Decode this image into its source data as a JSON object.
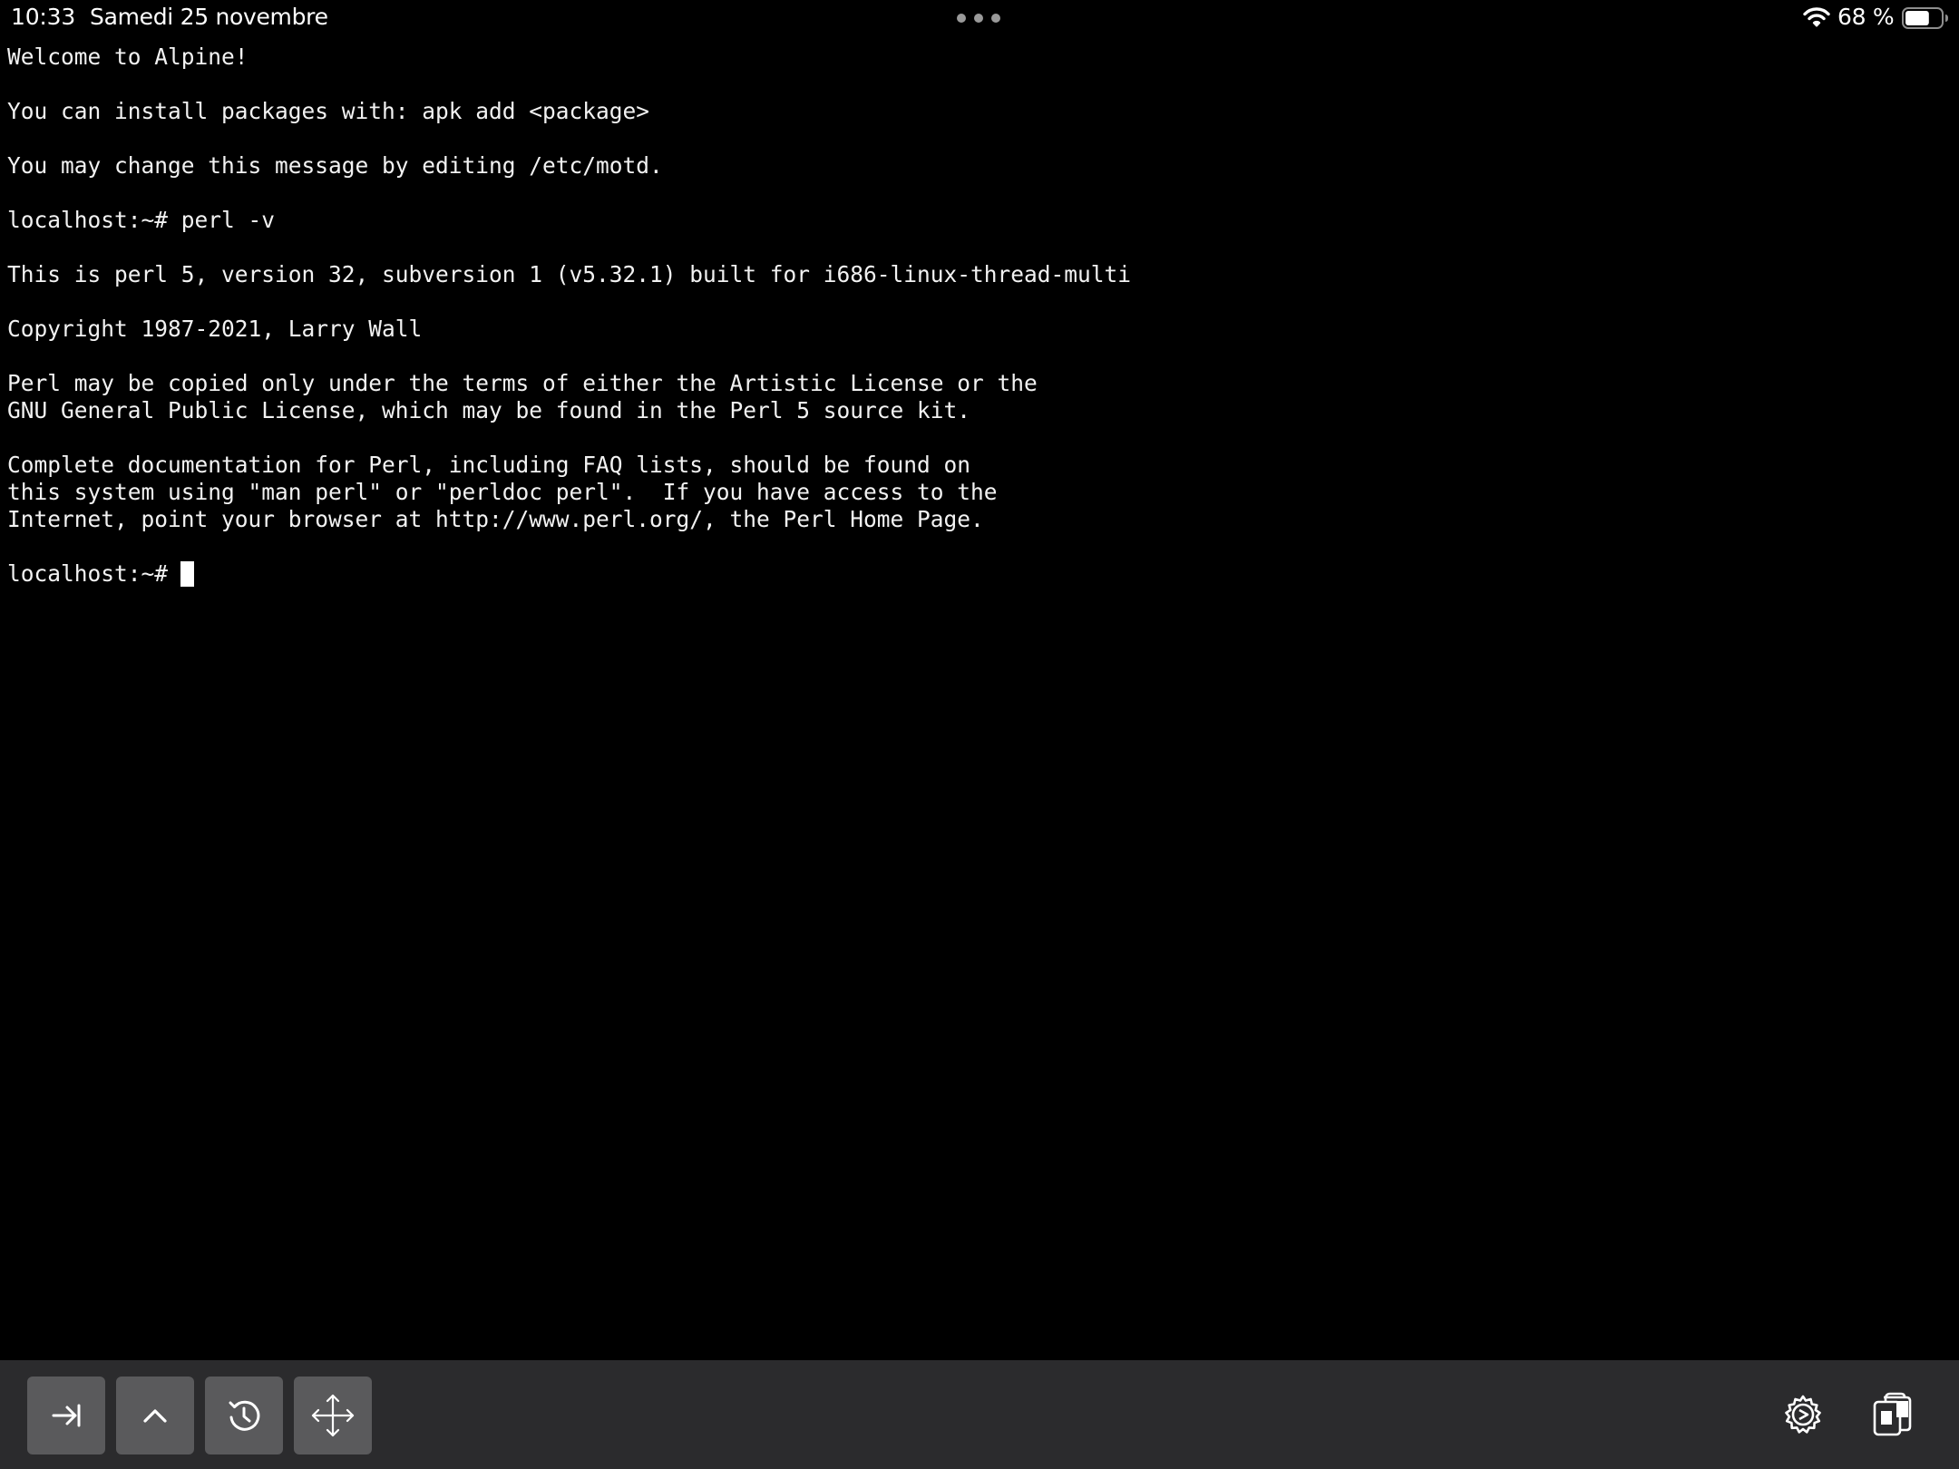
{
  "status_bar": {
    "time": "10:33",
    "date": "Samedi 25 novembre",
    "battery_percent": "68 %",
    "battery_level": 0.68,
    "icons": [
      "multitask-dots-icon",
      "wifi-icon",
      "battery-icon"
    ]
  },
  "terminal": {
    "output": "Welcome to Alpine!\n\nYou can install packages with: apk add <package>\n\nYou may change this message by editing /etc/motd.\n\nlocalhost:~# perl -v\n\nThis is perl 5, version 32, subversion 1 (v5.32.1) built for i686-linux-thread-multi\n\nCopyright 1987-2021, Larry Wall\n\nPerl may be copied only under the terms of either the Artistic License or the\nGNU General Public License, which may be found in the Perl 5 source kit.\n\nComplete documentation for Perl, including FAQ lists, should be found on\nthis system using \"man perl\" or \"perldoc perl\".  If you have access to the\nInternet, point your browser at http://www.perl.org/, the Perl Home Page.",
    "prompt": "localhost:~#",
    "background": "#000000",
    "foreground": "#f2f2f2"
  },
  "toolbar": {
    "background": "#2b2b2d",
    "button_color": "#5a5a5c",
    "buttons": [
      {
        "name": "tab",
        "icon": "tab-arrow-icon"
      },
      {
        "name": "control",
        "icon": "chevron-up-icon"
      },
      {
        "name": "history",
        "icon": "history-icon"
      },
      {
        "name": "arrows",
        "icon": "move-arrows-icon"
      }
    ],
    "right_buttons": [
      {
        "name": "settings",
        "icon": "gear-icon"
      },
      {
        "name": "paste",
        "icon": "clipboard-icon"
      }
    ]
  }
}
